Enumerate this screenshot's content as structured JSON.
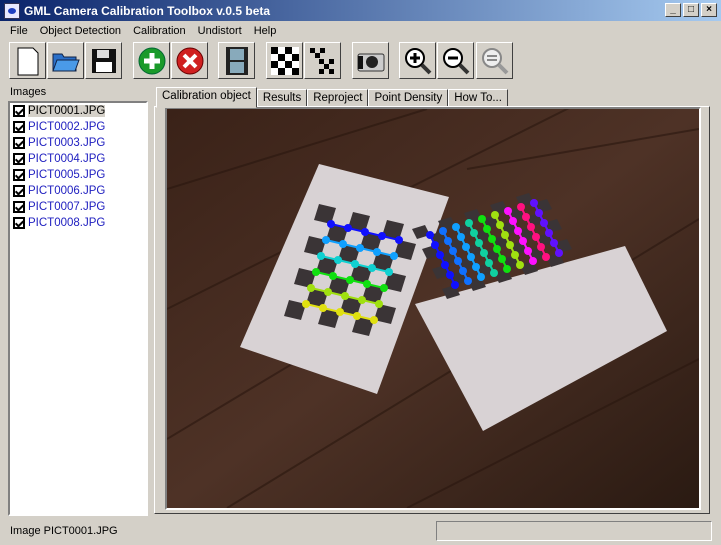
{
  "window": {
    "title": "GML Camera Calibration Toolbox  v.0.5 beta"
  },
  "menu": [
    "File",
    "Object Detection",
    "Calibration",
    "Undistort",
    "Help"
  ],
  "toolbar": [
    {
      "name": "new-button",
      "icon": "new-icon"
    },
    {
      "name": "open-button",
      "icon": "folder-open-icon"
    },
    {
      "name": "save-button",
      "icon": "floppy-icon"
    },
    {
      "name": "add-image-button",
      "icon": "plus-green-icon"
    },
    {
      "name": "remove-image-button",
      "icon": "x-red-icon"
    },
    {
      "name": "video-button",
      "icon": "film-icon"
    },
    {
      "name": "detect-button",
      "icon": "checkerboard-icon"
    },
    {
      "name": "detect-all-button",
      "icon": "checkerboards-icon"
    },
    {
      "name": "camera-button",
      "icon": "camera-icon"
    },
    {
      "name": "zoom-in-button",
      "icon": "zoom-in-icon"
    },
    {
      "name": "zoom-out-button",
      "icon": "zoom-out-icon"
    },
    {
      "name": "zoom-reset-button",
      "icon": "zoom-reset-icon"
    }
  ],
  "images_label": "Images",
  "files": [
    {
      "name": "PICT0001.JPG",
      "checked": true,
      "selected": true
    },
    {
      "name": "PICT0002.JPG",
      "checked": true
    },
    {
      "name": "PICT0003.JPG",
      "checked": true
    },
    {
      "name": "PICT0004.JPG",
      "checked": true
    },
    {
      "name": "PICT0005.JPG",
      "checked": true
    },
    {
      "name": "PICT0006.JPG",
      "checked": true
    },
    {
      "name": "PICT0007.JPG",
      "checked": true
    },
    {
      "name": "PICT0008.JPG",
      "checked": true
    }
  ],
  "tabs": [
    "Calibration object",
    "Results",
    "Reproject",
    "Point Density",
    "How To..."
  ],
  "status": "Image PICT0001.JPG",
  "colors": {
    "title_start": "#0a246a",
    "title_end": "#a6caf0",
    "file_text": "#2020c0"
  }
}
